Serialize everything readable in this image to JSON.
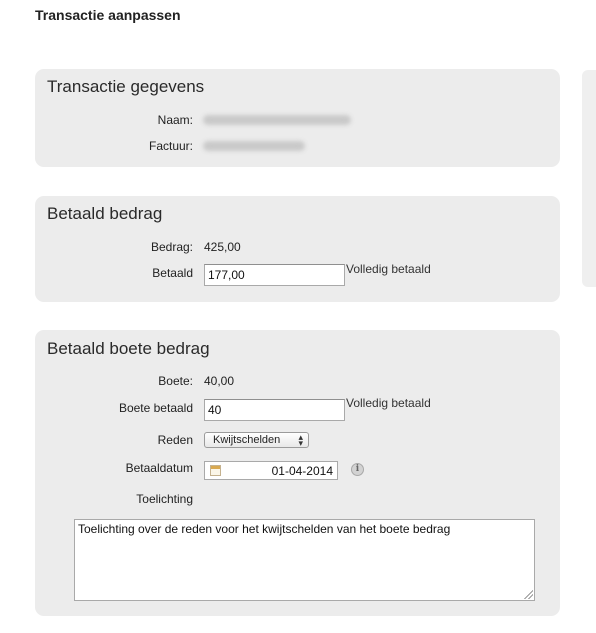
{
  "page": {
    "title": "Transactie aanpassen"
  },
  "transactie": {
    "title": "Transactie gegevens",
    "naam_label": "Naam:",
    "factuur_label": "Factuur:"
  },
  "betaald": {
    "title": "Betaald bedrag",
    "bedrag_label": "Bedrag:",
    "bedrag_value": "425,00",
    "betaald_label": "Betaald",
    "betaald_value": "177,00",
    "status": "Volledig betaald"
  },
  "boete": {
    "title": "Betaald boete bedrag",
    "boete_label": "Boete:",
    "boete_value": "40,00",
    "boete_betaald_label": "Boete betaald",
    "boete_betaald_value": "40",
    "status": "Volledig betaald",
    "reden_label": "Reden",
    "reden_value": "Kwijtschelden",
    "betaaldatum_label": "Betaaldatum",
    "betaaldatum_value": "01-04-2014",
    "toelichting_label": "Toelichting",
    "toelichting_value": "Toelichting over de reden voor het kwijtschelden van het boete bedrag"
  },
  "icons": {
    "calendar": "calendar-icon",
    "info": "info-icon",
    "select_arrow": "chevron-up-down-icon"
  }
}
